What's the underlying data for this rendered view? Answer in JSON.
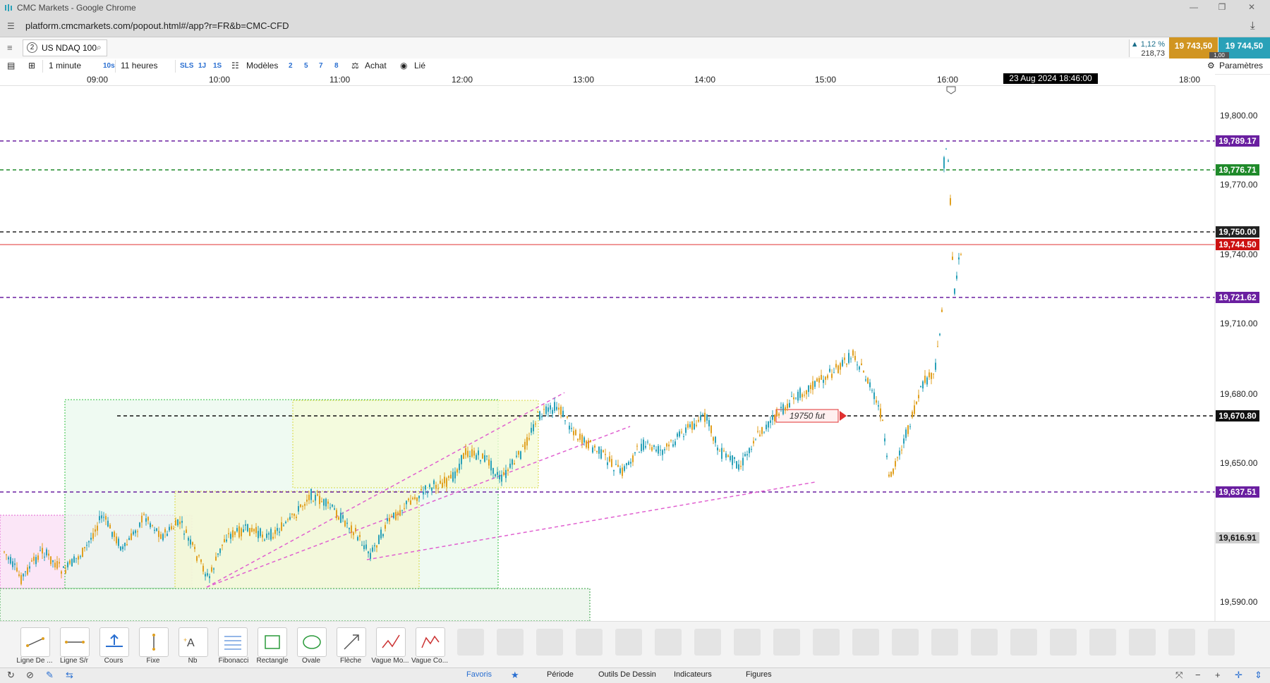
{
  "browser": {
    "window_title": "CMC Markets - Google Chrome",
    "url": "platform.cmcmarkets.com/popout.html#/app?r=FR&b=CMC-CFD"
  },
  "instrument": {
    "tab_number": "2",
    "name": "US NDAQ 100",
    "change_pct": "▲ 1,12 %",
    "change_pts": "218,73",
    "sell_price": "19 743,50",
    "buy_price": "19 744,50",
    "spread": "1,00"
  },
  "toolbar": {
    "interval": "1 minute",
    "span": "11 heures",
    "quick_intervals": [
      "10s",
      "SLS",
      "1J",
      "1S"
    ],
    "models_label": "Modèles",
    "model_slots": [
      "2",
      "5",
      "7",
      "8"
    ],
    "buy_label": "Achat",
    "linked_label": "Lié",
    "settings_label": "Paramètres"
  },
  "time_axis": {
    "labels": [
      "09:00",
      "10:00",
      "11:00",
      "12:00",
      "13:00",
      "14:00",
      "15:00",
      "16:00",
      "18:00"
    ],
    "current_time": "23 Aug 2024 18:46:00"
  },
  "price_axis": {
    "labels": [
      "19,800.00",
      "19,770.00",
      "19,740.00",
      "19,710.00",
      "19,680.00",
      "19,650.00",
      "19,590.00"
    ],
    "tags": [
      {
        "value": "19,789.17",
        "color": "#6a1fa0"
      },
      {
        "value": "19,776.71",
        "color": "#1f8a2a"
      },
      {
        "value": "19,750.00",
        "color": "#222222"
      },
      {
        "value": "19,744.50",
        "color": "#cc1111"
      },
      {
        "value": "19,721.62",
        "color": "#6a1fa0"
      },
      {
        "value": "19,670.80",
        "color": "#111111"
      },
      {
        "value": "19,637.51",
        "color": "#6a1fa0"
      },
      {
        "value": "19,616.91",
        "color": "#888888"
      }
    ]
  },
  "annotation": {
    "text": "19750 fut"
  },
  "drawing_tools": [
    {
      "label": "Ligne De ...",
      "icon": "trend-line-icon"
    },
    {
      "label": "Ligne S/r",
      "icon": "horizontal-line-icon"
    },
    {
      "label": "Cours",
      "icon": "price-line-icon"
    },
    {
      "label": "Fixe",
      "icon": "vertical-line-icon"
    },
    {
      "label": "Nb",
      "icon": "text-icon"
    },
    {
      "label": "Fibonacci",
      "icon": "fibonacci-icon"
    },
    {
      "label": "Rectangle",
      "icon": "rectangle-icon"
    },
    {
      "label": "Ovale",
      "icon": "oval-icon"
    },
    {
      "label": "Flèche",
      "icon": "arrow-icon"
    },
    {
      "label": "Vague Mo...",
      "icon": "wave-icon"
    },
    {
      "label": "Vague Co...",
      "icon": "corrective-wave-icon"
    }
  ],
  "bottom_tabs": [
    "Favoris",
    "Période",
    "Outils De Dessin",
    "Indicateurs",
    "Figures"
  ],
  "colors": {
    "sell": "#d19521",
    "buy": "#2aa1b8",
    "candle_up": "#2aa1b8",
    "candle_down": "#e0a020"
  }
}
